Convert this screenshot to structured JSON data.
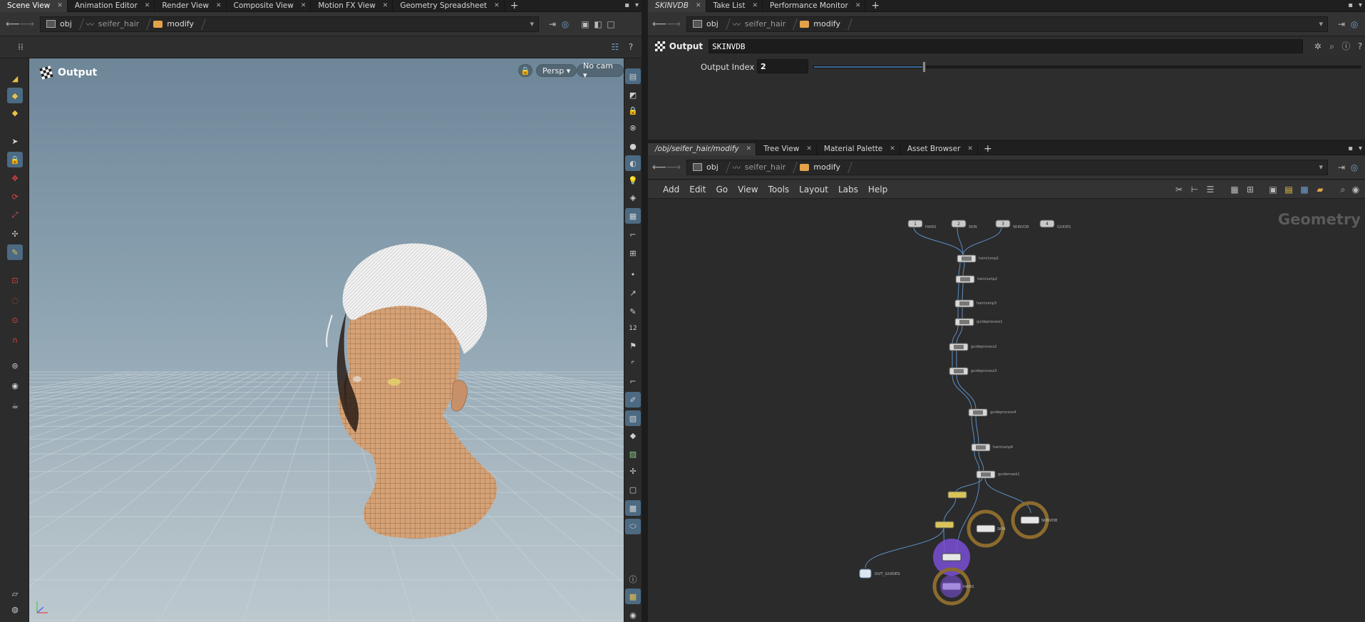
{
  "left_tabs": [
    {
      "label": "Scene View",
      "active": true
    },
    {
      "label": "Animation Editor",
      "active": false
    },
    {
      "label": "Render View",
      "active": false
    },
    {
      "label": "Composite View",
      "active": false
    },
    {
      "label": "Motion FX View",
      "active": false
    },
    {
      "label": "Geometry Spreadsheet",
      "active": false
    }
  ],
  "right_top_tabs": [
    {
      "label": "SKINVDB",
      "active": true
    },
    {
      "label": "Take List",
      "active": false
    },
    {
      "label": "Performance Monitor",
      "active": false
    }
  ],
  "right_bottom_tabs": [
    {
      "label": "/obj/seifer_hair/modify",
      "active": true
    },
    {
      "label": "Tree View",
      "active": false
    },
    {
      "label": "Material Palette",
      "active": false
    },
    {
      "label": "Asset Browser",
      "active": false
    }
  ],
  "path": {
    "obj": "obj",
    "hair": "seifer_hair",
    "modify": "modify"
  },
  "viewport": {
    "title": "Output",
    "persp_label": "Persp ▾",
    "cam_label": "No cam ▾"
  },
  "params": {
    "node_type": "Output",
    "node_name": "SKINVDB",
    "output_index_label": "Output Index",
    "output_index_value": "2",
    "slider_fraction": 0.2
  },
  "network_menu": [
    "Add",
    "Edit",
    "Go",
    "View",
    "Tools",
    "Layout",
    "Labs",
    "Help"
  ],
  "network_watermark": "Geometry",
  "network_nodes": {
    "inputs": [
      "1",
      "2",
      "3",
      "4"
    ],
    "input_labels": [
      "HAIRS",
      "SKIN",
      "SKINVDB",
      "GUIDES"
    ],
    "chain": [
      "hairclump1",
      "hairclump2",
      "hairclump3",
      "guideprocess1",
      "guideprocess2",
      "guideprocess3",
      "guideprocess4",
      "hairclump4",
      "guidemask1"
    ],
    "outputs": [
      "OUT_GUIDES",
      "SKIN",
      "SKINVDB",
      "HAIRS"
    ]
  },
  "colors": {
    "accent_selected": "#4c6a82",
    "output_ring": "#8b6b2e",
    "selected_node": "#7a4fd6",
    "folder": "#e3a24a"
  }
}
